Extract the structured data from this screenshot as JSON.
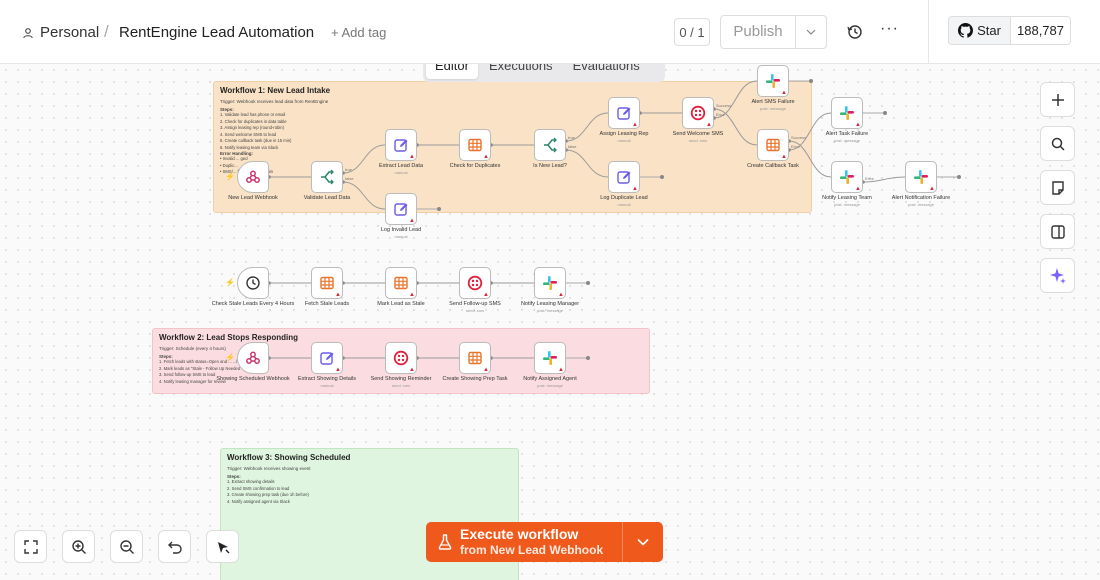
{
  "header": {
    "personal": "Personal",
    "separator": "/",
    "workflow_title": "RentEngine Lead Automation",
    "add_tag": "+ Add tag",
    "counter": "0 / 1",
    "publish": "Publish",
    "more": "···",
    "star_label": "Star",
    "star_count": "188,787"
  },
  "tabs": [
    "Editor",
    "Executions",
    "Evaluations"
  ],
  "stickies": {
    "w1": {
      "title": "Workflow 1: New Lead Intake",
      "trigger": "Trigger: Webhook receives lead data from RentEngine",
      "steps_label": "Steps:",
      "steps": [
        "1. Validate lead has phone or email",
        "2. Check for duplicates in data table",
        "3. Assign leasing rep (round-robin)",
        "4. Send welcome SMS to lead",
        "5. Create callback task (due in 15 min)",
        "6. Notify leasing team via Slack"
      ],
      "error_label": "Error Handling:",
      "errors": [
        "• Invalid ... ged",
        "• Duplic...",
        "• SMS/... failures alert admin"
      ]
    },
    "w2": {
      "title": "Workflow 2: Lead Stops Responding",
      "trigger": "Trigger: Schedule (every 4 hours)",
      "steps_label": "Steps:",
      "steps": [
        "1. Fetch leads with status=Open and ... ...h",
        "2. Mark leads as \"Stale - Follow Up Needed\"",
        "3. Send follow-up SMS to lead",
        "4. Notify leasing manager for review"
      ]
    },
    "w3": {
      "title": "Workflow 3: Showing Scheduled",
      "trigger": "Trigger: Webhook receives showing event",
      "steps_label": "Steps:",
      "steps": [
        "1. Extract showing details",
        "2. Send SMS confirmation to lead",
        "3. Create showing prep task (due 1h before)",
        "4. Notify assigned agent via Slack"
      ]
    }
  },
  "nodes": [
    {
      "id": "webhook1",
      "label": "New Lead Webhook",
      "sub": "",
      "icon": "webhook-icon",
      "kind": "trigger"
    },
    {
      "id": "validate",
      "label": "Validate Lead Data",
      "sub": "",
      "icon": "if-icon"
    },
    {
      "id": "extract",
      "label": "Extract Lead Data",
      "sub": "manual",
      "icon": "edit-icon"
    },
    {
      "id": "invalid",
      "label": "Log Invalid Lead",
      "sub": "manual",
      "icon": "edit-icon"
    },
    {
      "id": "dupcheck",
      "label": "Check for Duplicates",
      "sub": "",
      "icon": "table-icon"
    },
    {
      "id": "isnew",
      "label": "Is New Lead?",
      "sub": "",
      "icon": "if-icon"
    },
    {
      "id": "assign",
      "label": "Assign Leasing Rep",
      "sub": "manual",
      "icon": "edit-icon"
    },
    {
      "id": "logdup",
      "label": "Log Duplicate Lead",
      "sub": "manual",
      "icon": "edit-icon"
    },
    {
      "id": "welcome",
      "label": "Send Welcome SMS",
      "sub": "send: sms",
      "icon": "twilio-icon"
    },
    {
      "id": "smsfail",
      "label": "Alert SMS Failure",
      "sub": "post: message",
      "icon": "slack-icon"
    },
    {
      "id": "callback",
      "label": "Create Callback Task",
      "sub": "",
      "icon": "table-icon"
    },
    {
      "id": "taskfail",
      "label": "Alert Task Failure",
      "sub": "post: message",
      "icon": "slack-icon"
    },
    {
      "id": "notifyteam",
      "label": "Notify Leasing Team",
      "sub": "post: message",
      "icon": "slack-icon"
    },
    {
      "id": "notifyfail",
      "label": "Alert Notification Failure",
      "sub": "post: message",
      "icon": "slack-icon"
    },
    {
      "id": "schedule",
      "label": "Check Stale Leads Every 4 Hours",
      "sub": "",
      "icon": "clock-icon",
      "kind": "trigger"
    },
    {
      "id": "fetchstale",
      "label": "Fetch Stale Leads",
      "sub": "",
      "icon": "table-icon"
    },
    {
      "id": "markstale",
      "label": "Mark Lead as Stale",
      "sub": "",
      "icon": "table-icon"
    },
    {
      "id": "followup",
      "label": "Send Follow-up SMS",
      "sub": "send: sms",
      "icon": "twilio-icon"
    },
    {
      "id": "notifymgr",
      "label": "Notify Leasing Manager",
      "sub": "post: message",
      "icon": "slack-icon"
    },
    {
      "id": "webhook3",
      "label": "Showing Scheduled Webhook",
      "sub": "",
      "icon": "webhook-icon",
      "kind": "trigger"
    },
    {
      "id": "extractshow",
      "label": "Extract Showing Details",
      "sub": "manual",
      "icon": "edit-icon"
    },
    {
      "id": "reminder",
      "label": "Send Showing Reminder",
      "sub": "send: sms",
      "icon": "twilio-icon"
    },
    {
      "id": "preptask",
      "label": "Create Showing Prep Task",
      "sub": "",
      "icon": "table-icon"
    },
    {
      "id": "notifyagent",
      "label": "Notify Assigned Agent",
      "sub": "post: message",
      "icon": "slack-icon"
    }
  ],
  "edge_labels": {
    "true": "true",
    "false": "false",
    "success": "Success",
    "error": "Error"
  },
  "execute": {
    "title": "Execute workflow",
    "subtitle": "from New Lead Webhook"
  },
  "right_tools": [
    "plus-icon",
    "search-icon",
    "sticky-note-icon",
    "panel-icon",
    "ai-sparkle-icon"
  ],
  "bottom_tools": [
    "fit-view-icon",
    "zoom-in-icon",
    "zoom-out-icon",
    "undo-icon",
    "cleanup-icon"
  ],
  "colors": {
    "accent": "#ef5a1c",
    "sticky_orange": "#f9e2c6",
    "sticky_pink": "#fbdde1",
    "sticky_green": "#dff5df",
    "error": "#d62839",
    "twilio": "#e31e3a",
    "edit": "#6b5ce7"
  }
}
